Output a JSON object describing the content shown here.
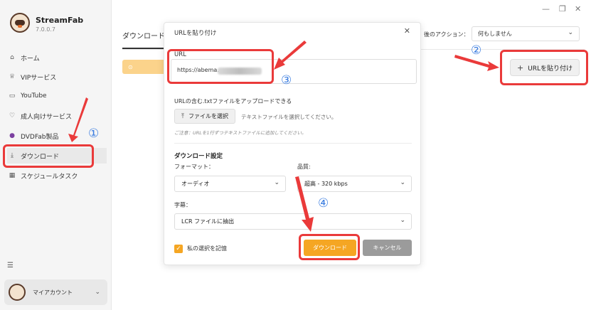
{
  "app": {
    "title": "StreamFab",
    "version": "7.0.0.7"
  },
  "sidebar": {
    "items": [
      {
        "label": "ホーム",
        "icon": "home-icon"
      },
      {
        "label": "VIPサービス",
        "icon": "vip-icon"
      },
      {
        "label": "YouTube",
        "icon": "youtube-icon"
      },
      {
        "label": "成人向けサービス",
        "icon": "heart-icon"
      },
      {
        "label": "DVDFab製品",
        "icon": "dvdfab-icon"
      },
      {
        "label": "ダウンロード",
        "icon": "download-icon"
      },
      {
        "label": "スケジュールタスク",
        "icon": "calendar-icon"
      }
    ],
    "account_label": "マイアカウント"
  },
  "main": {
    "tab_label": "ダウンロード中",
    "after_action_label": "後のアクション：",
    "after_action_value": "何もしません",
    "paste_url_label": "URLを貼り付け"
  },
  "modal": {
    "title": "URLを貼り付け",
    "url_label": "URL",
    "url_value": "https://abema.",
    "upload_label": "URLの含む.txtファイルをアップロードできる",
    "file_button": "ファイルを選択",
    "file_hint": "テキストファイルを選択してください。",
    "note": "ご注意：URLを1行ずつテキストファイルに追加してください。",
    "download_settings": "ダウンロード設定",
    "format_label": "フォーマット：",
    "format_value": "オーディオ",
    "quality_label": "品質:",
    "quality_value": "超高 - 320 kbps",
    "subtitle_label": "字幕：",
    "subtitle_value": "LCR ファイルに抽出",
    "remember_label": "私の選択を記憶",
    "download_button": "ダウンロード",
    "cancel_button": "キャンセル"
  },
  "annotations": {
    "step1": "①",
    "step2": "②",
    "step3": "③",
    "step4": "④",
    "highlight_color": "#ea3a3a",
    "marker_color": "#3b7de0"
  }
}
